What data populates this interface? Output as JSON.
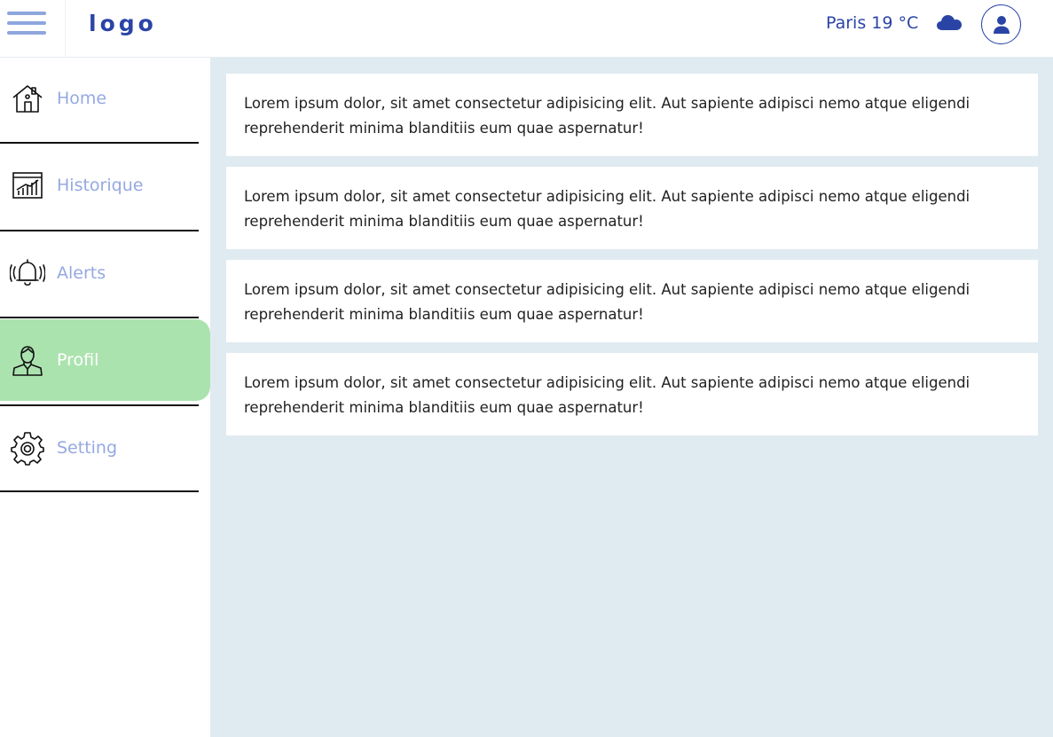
{
  "header": {
    "logo": "logo",
    "weather": "Paris 19 °C"
  },
  "icons": {
    "menu": "hamburger-icon",
    "weather": "cloud-icon",
    "user": "user-icon"
  },
  "colors": {
    "brand": "#2a44a6",
    "nav_text": "#95a9e0",
    "active_bg": "#abe3ae",
    "content_bg": "#e0eaf1"
  },
  "sidebar": {
    "items": [
      {
        "label": "Home",
        "icon": "home-icon"
      },
      {
        "label": "Historique",
        "icon": "chart-icon"
      },
      {
        "label": "Alerts",
        "icon": "bell-icon"
      },
      {
        "label": "Profil",
        "icon": "profile-icon",
        "active": true
      },
      {
        "label": "Setting",
        "icon": "gear-icon"
      }
    ]
  },
  "cards": [
    {
      "text": "Lorem ipsum dolor, sit amet consectetur adipisicing elit. Aut sapiente adipisci nemo atque eligendi reprehenderit minima blanditiis eum quae aspernatur!"
    },
    {
      "text": "Lorem ipsum dolor, sit amet consectetur adipisicing elit. Aut sapiente adipisci nemo atque eligendi reprehenderit minima blanditiis eum quae aspernatur!"
    },
    {
      "text": "Lorem ipsum dolor, sit amet consectetur adipisicing elit. Aut sapiente adipisci nemo atque eligendi reprehenderit minima blanditiis eum quae aspernatur!"
    },
    {
      "text": "Lorem ipsum dolor, sit amet consectetur adipisicing elit. Aut sapiente adipisci nemo atque eligendi reprehenderit minima blanditiis eum quae aspernatur!"
    }
  ]
}
